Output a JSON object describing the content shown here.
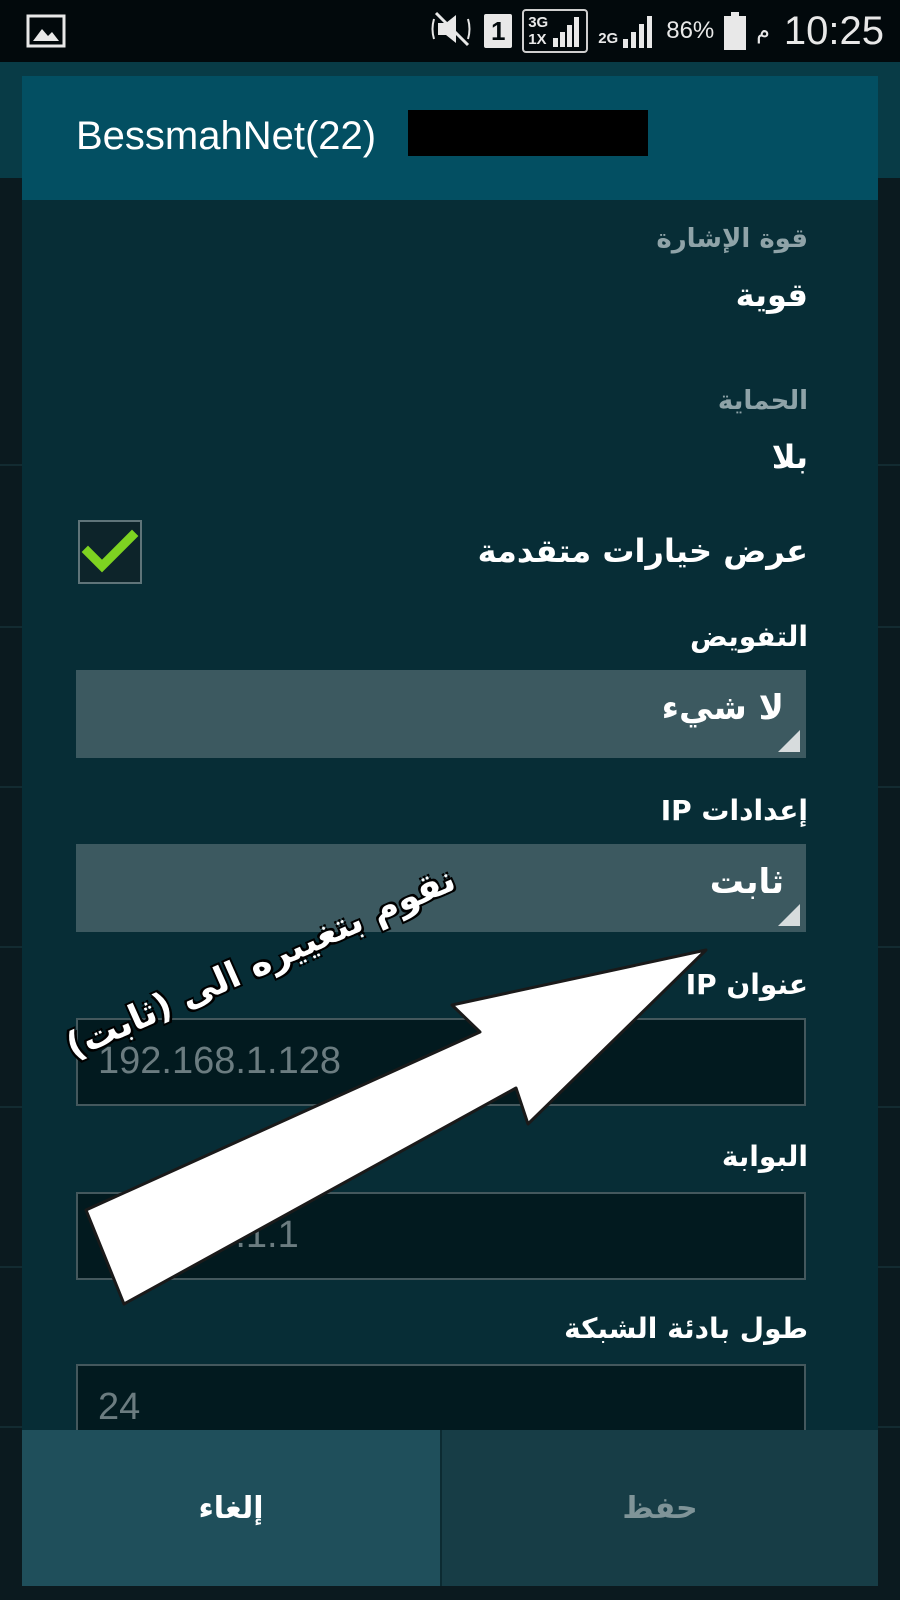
{
  "status_bar": {
    "network_3g": "3G",
    "network_1x": "1X",
    "network_2g": "2G",
    "sim_slot": "1",
    "battery_percent": "86%",
    "time": "10:25",
    "ampm": "م",
    "icons": [
      "gallery-icon",
      "mute-icon",
      "sim-icon",
      "signal-3g-icon",
      "signal-2g-icon",
      "battery-icon"
    ]
  },
  "dialog": {
    "title": "BessmahNet(22)",
    "signal_strength": {
      "label": "قوة الإشارة",
      "value": "قوية"
    },
    "security": {
      "label": "الحماية",
      "value": "بلا"
    },
    "advanced_options": {
      "label": "عرض خيارات متقدمة",
      "checked": true
    },
    "proxy": {
      "label": "التفويض",
      "value": "لا شيء"
    },
    "ip_settings": {
      "label": "إعدادات IP",
      "value": "ثابت"
    },
    "ip_address": {
      "label": "عنوان IP",
      "value": "192.168.1.128"
    },
    "gateway": {
      "label": "البوابة",
      "value": "192.168.1.1"
    },
    "prefix_length": {
      "label": "طول بادئة الشبكة",
      "value": "24"
    },
    "buttons": {
      "cancel": "إلغاء",
      "save": "حفظ"
    }
  },
  "annotation": {
    "text": "نقوم بتغييره الى (ثابت)"
  },
  "colors": {
    "title_bar": "#034f62",
    "dialog_bg": "#072d36",
    "spinner_bg": "#3c5960",
    "check_mark": "#7ed321"
  }
}
